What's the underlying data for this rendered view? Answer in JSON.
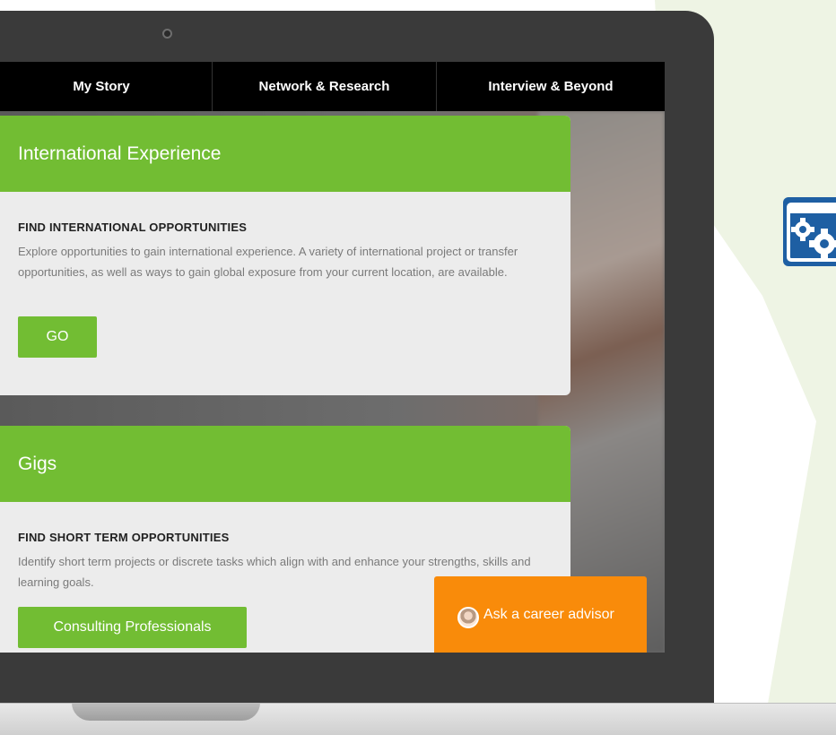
{
  "nav": {
    "items": [
      {
        "label": "My Story"
      },
      {
        "label": "Network & Research"
      },
      {
        "label": "Interview & Beyond"
      }
    ]
  },
  "cards": [
    {
      "title": "International Experience",
      "subtitle": "FIND INTERNATIONAL OPPORTUNITIES",
      "text": "Explore opportunities to gain international experience. A variety of international project or transfer opportunities, as well as ways to gain global exposure from your current location, are available.",
      "button_label": "GO"
    },
    {
      "title": "Gigs",
      "subtitle": "FIND SHORT TERM OPPORTUNITIES",
      "text": "Identify short term projects or discrete tasks which align with and enhance your strengths, skills and learning goals.",
      "button_label": "Consulting Professionals"
    }
  ],
  "advisor": {
    "label": "Ask a career advisor"
  },
  "icons": {
    "side_icon": "gears-window-icon",
    "advisor_icon": "advisor-avatar"
  },
  "colors": {
    "accent_green": "#72bd33",
    "advisor_orange": "#f98b0a",
    "nav_black": "#000000",
    "icon_blue": "#1e5fa3"
  }
}
